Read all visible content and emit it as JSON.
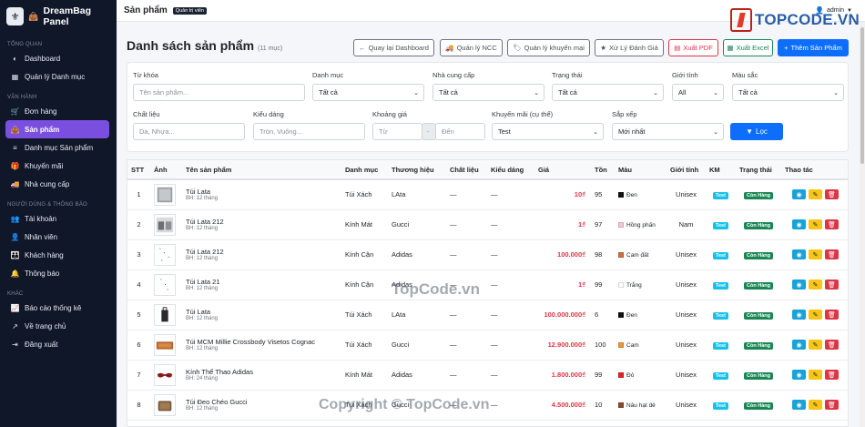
{
  "app": {
    "brand": "DreamBag Panel",
    "top_title": "Sản phẩm",
    "role_badge": "Quản trị viên",
    "admin_label": "admin"
  },
  "logo_overlay": {
    "text": "TOPCODE.VN"
  },
  "watermarks": {
    "center": "TopCode.vn",
    "bottom": "Copyright © TopCode.vn"
  },
  "sidebar": {
    "sections": [
      {
        "title": "TỔNG QUAN",
        "items": [
          {
            "label": "Dashboard",
            "icon": "gauge-icon"
          },
          {
            "label": "Quản lý Danh mục",
            "icon": "grid-icon"
          }
        ]
      },
      {
        "title": "VẬN HÀNH",
        "items": [
          {
            "label": "Đơn hàng",
            "icon": "cart-icon"
          },
          {
            "label": "Sản phẩm",
            "icon": "bag-icon",
            "active": true
          },
          {
            "label": "Danh mục Sản phẩm",
            "icon": "layers-icon"
          },
          {
            "label": "Khuyến mãi",
            "icon": "gift-icon"
          },
          {
            "label": "Nhà cung cấp",
            "icon": "truck-icon"
          }
        ]
      },
      {
        "title": "NGƯỜI DÙNG & THÔNG BÁO",
        "items": [
          {
            "label": "Tài khoản",
            "icon": "users-icon"
          },
          {
            "label": "Nhân viên",
            "icon": "user-tie-icon"
          },
          {
            "label": "Khách hàng",
            "icon": "user-group-icon"
          },
          {
            "label": "Thông báo",
            "icon": "bell-icon"
          }
        ]
      },
      {
        "title": "KHÁC",
        "items": [
          {
            "label": "Báo cáo thống kê",
            "icon": "chart-icon"
          },
          {
            "label": "Về trang chủ",
            "icon": "external-icon"
          },
          {
            "label": "Đăng xuất",
            "icon": "logout-icon"
          }
        ]
      }
    ]
  },
  "header": {
    "title": "Danh sách sản phẩm",
    "count": "(11 mục)"
  },
  "toolbar": {
    "back": "Quay lại Dashboard",
    "ncc": "Quản lý NCC",
    "promo": "Quản lý khuyến mại",
    "review": "Xử Lý Đánh Giá",
    "pdf": "Xuất PDF",
    "excel": "Xuất Excel",
    "add": "Thêm Sản Phẩm"
  },
  "filters": {
    "keyword": {
      "label": "Từ khóa",
      "placeholder": "Tên sản phẩm..."
    },
    "category": {
      "label": "Danh mục",
      "value": "Tất cả"
    },
    "supplier": {
      "label": "Nhà cung cấp",
      "value": "Tất cả"
    },
    "status": {
      "label": "Trạng thái",
      "value": "Tất cả"
    },
    "gender": {
      "label": "Giới tính",
      "value": "All"
    },
    "color": {
      "label": "Màu sắc",
      "value": "Tất cả"
    },
    "material": {
      "label": "Chất liệu",
      "placeholder": "Da, Nhựa..."
    },
    "style": {
      "label": "Kiểu dáng",
      "placeholder": "Tròn, Vuông..."
    },
    "price": {
      "label": "Khoảng giá",
      "from": "Từ",
      "sep": "-",
      "to": "Đến"
    },
    "promo": {
      "label": "Khuyến mãi (cụ thể)",
      "value": "Test"
    },
    "sort": {
      "label": "Sắp xếp",
      "value": "Mới nhất"
    },
    "submit": "Lọc"
  },
  "table": {
    "headers": [
      "STT",
      "Ảnh",
      "Tên sản phẩm",
      "Danh mục",
      "Thương hiệu",
      "Chất liệu",
      "Kiểu dáng",
      "Giá",
      "Tồn",
      "Màu",
      "Giới tính",
      "KM",
      "Trạng thái",
      "Thao tác"
    ],
    "rows": [
      {
        "stt": "1",
        "name": "Túi Lata",
        "bh": "BH: 12 tháng",
        "cat": "Túi Xách",
        "brand": "LAta",
        "mat": "—",
        "style": "—",
        "price": "10₫",
        "stock": "95",
        "color": "Đen",
        "hex": "#111111",
        "gender": "Unisex",
        "km": "Test",
        "status": "Còn Hàng"
      },
      {
        "stt": "2",
        "name": "Túi Lata 212",
        "bh": "BH: 12 tháng",
        "cat": "Kính Mát",
        "brand": "Gucci",
        "mat": "—",
        "style": "—",
        "price": "1₫",
        "stock": "97",
        "color": "Hồng phấn",
        "hex": "#f7c6d0",
        "gender": "Nam",
        "km": "Test",
        "status": "Còn Hàng"
      },
      {
        "stt": "3",
        "name": "Túi Lata 212",
        "bh": "BH: 12 tháng",
        "cat": "Kính Cận",
        "brand": "Adidas",
        "mat": "—",
        "style": "—",
        "price": "100.000₫",
        "stock": "98",
        "color": "Cam đất",
        "hex": "#c8733f",
        "gender": "Unisex",
        "km": "Test",
        "status": "Còn Hàng"
      },
      {
        "stt": "4",
        "name": "Túi Lata 21",
        "bh": "BH: 12 tháng",
        "cat": "Kính Cận",
        "brand": "Adidas",
        "mat": "—",
        "style": "—",
        "price": "1₫",
        "stock": "99",
        "color": "Trắng",
        "hex": "#ffffff",
        "gender": "Unisex",
        "km": "Test",
        "status": "Còn Hàng"
      },
      {
        "stt": "5",
        "name": "Túi Lata",
        "bh": "BH: 12 tháng",
        "cat": "Túi Xách",
        "brand": "LAta",
        "mat": "—",
        "style": "—",
        "price": "100.000.000₫",
        "stock": "6",
        "color": "Đen",
        "hex": "#111111",
        "gender": "Unisex",
        "km": "Test",
        "status": "Còn Hàng"
      },
      {
        "stt": "6",
        "name": "Túi MCM Millie Crossbody Visetos Cognac",
        "bh": "BH: 12 tháng",
        "cat": "Túi Xách",
        "brand": "Gucci",
        "mat": "—",
        "style": "—",
        "price": "12.900.000₫",
        "stock": "100",
        "color": "Cam",
        "hex": "#f0973a",
        "gender": "Unisex",
        "km": "Test",
        "status": "Còn Hàng"
      },
      {
        "stt": "7",
        "name": "Kính Thể Thao Adidas",
        "bh": "BH: 24 tháng",
        "cat": "Kính Mát",
        "brand": "Adidas",
        "mat": "—",
        "style": "—",
        "price": "1.800.000₫",
        "stock": "99",
        "color": "Đỏ",
        "hex": "#e32222",
        "gender": "Unisex",
        "km": "Test",
        "status": "Còn Hàng"
      },
      {
        "stt": "8",
        "name": "Túi Đeo Chéo Gucci",
        "bh": "BH: 12 tháng",
        "cat": "Túi Xách",
        "brand": "Gucci",
        "mat": "—",
        "style": "—",
        "price": "4.500.000₫",
        "stock": "10",
        "color": "Nâu hạt dẻ",
        "hex": "#8b4a2b",
        "gender": "Unisex",
        "km": "Test",
        "status": "Còn Hàng"
      }
    ]
  }
}
